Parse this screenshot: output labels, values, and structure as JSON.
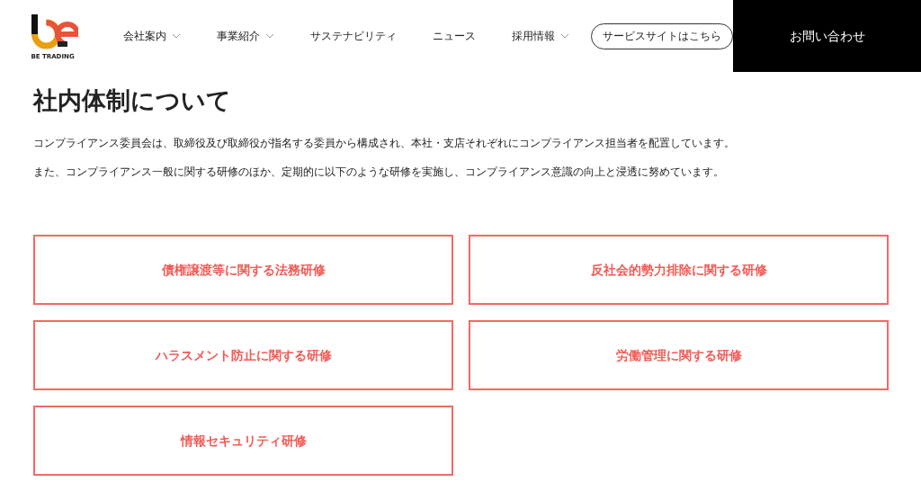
{
  "logo": {
    "tagline": "BE TRADING"
  },
  "nav": [
    {
      "label": "会社案内",
      "has_dropdown": true
    },
    {
      "label": "事業紹介",
      "has_dropdown": true
    },
    {
      "label": "サステナビリティ",
      "has_dropdown": false
    },
    {
      "label": "ニュース",
      "has_dropdown": false
    },
    {
      "label": "採用情報",
      "has_dropdown": true
    }
  ],
  "service_button": "サービスサイトはこちら",
  "contact_button": "お問い合わせ",
  "heading": "社内体制について",
  "paragraphs": [
    "コンプライアンス委員会は、取締役及び取締役が指名する委員から構成され、本社・支店それぞれにコンプライアンス担当者を配置しています。",
    "また、コンプライアンス一般に関する研修のほか、定期的に以下のような研修を実施し、コンプライアンス意識の向上と浸透に努めています。"
  ],
  "trainings": [
    "債権譲渡等に関する法務研修",
    "反社会的勢力排除に関する研修",
    "ハラスメント防止に関する研修",
    "労働管理に関する研修",
    "情報セキュリティ研修"
  ]
}
